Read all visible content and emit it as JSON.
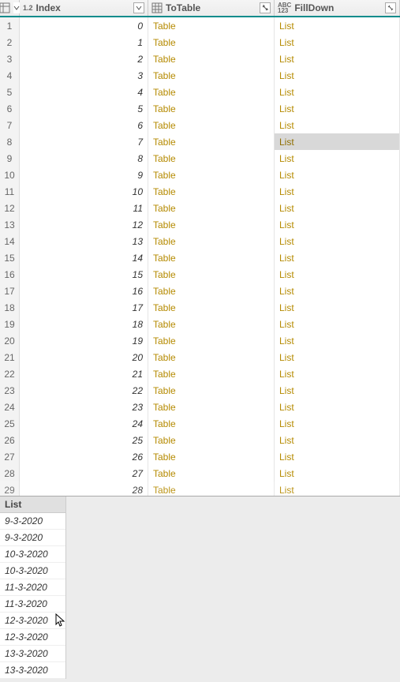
{
  "columns": {
    "index": {
      "label": "Index"
    },
    "totable": {
      "label": "ToTable"
    },
    "filldown": {
      "label": "FillDown"
    }
  },
  "rows": [
    {
      "n": "1",
      "idx": "0",
      "tbl": "Table",
      "fd": "List"
    },
    {
      "n": "2",
      "idx": "1",
      "tbl": "Table",
      "fd": "List"
    },
    {
      "n": "3",
      "idx": "2",
      "tbl": "Table",
      "fd": "List"
    },
    {
      "n": "4",
      "idx": "3",
      "tbl": "Table",
      "fd": "List"
    },
    {
      "n": "5",
      "idx": "4",
      "tbl": "Table",
      "fd": "List"
    },
    {
      "n": "6",
      "idx": "5",
      "tbl": "Table",
      "fd": "List"
    },
    {
      "n": "7",
      "idx": "6",
      "tbl": "Table",
      "fd": "List"
    },
    {
      "n": "8",
      "idx": "7",
      "tbl": "Table",
      "fd": "List",
      "selected": true
    },
    {
      "n": "9",
      "idx": "8",
      "tbl": "Table",
      "fd": "List"
    },
    {
      "n": "10",
      "idx": "9",
      "tbl": "Table",
      "fd": "List"
    },
    {
      "n": "11",
      "idx": "10",
      "tbl": "Table",
      "fd": "List"
    },
    {
      "n": "12",
      "idx": "11",
      "tbl": "Table",
      "fd": "List"
    },
    {
      "n": "13",
      "idx": "12",
      "tbl": "Table",
      "fd": "List"
    },
    {
      "n": "14",
      "idx": "13",
      "tbl": "Table",
      "fd": "List"
    },
    {
      "n": "15",
      "idx": "14",
      "tbl": "Table",
      "fd": "List"
    },
    {
      "n": "16",
      "idx": "15",
      "tbl": "Table",
      "fd": "List"
    },
    {
      "n": "17",
      "idx": "16",
      "tbl": "Table",
      "fd": "List"
    },
    {
      "n": "18",
      "idx": "17",
      "tbl": "Table",
      "fd": "List"
    },
    {
      "n": "19",
      "idx": "18",
      "tbl": "Table",
      "fd": "List"
    },
    {
      "n": "20",
      "idx": "19",
      "tbl": "Table",
      "fd": "List"
    },
    {
      "n": "21",
      "idx": "20",
      "tbl": "Table",
      "fd": "List"
    },
    {
      "n": "22",
      "idx": "21",
      "tbl": "Table",
      "fd": "List"
    },
    {
      "n": "23",
      "idx": "22",
      "tbl": "Table",
      "fd": "List"
    },
    {
      "n": "24",
      "idx": "23",
      "tbl": "Table",
      "fd": "List"
    },
    {
      "n": "25",
      "idx": "24",
      "tbl": "Table",
      "fd": "List"
    },
    {
      "n": "26",
      "idx": "25",
      "tbl": "Table",
      "fd": "List"
    },
    {
      "n": "27",
      "idx": "26",
      "tbl": "Table",
      "fd": "List"
    },
    {
      "n": "28",
      "idx": "27",
      "tbl": "Table",
      "fd": "List"
    },
    {
      "n": "29",
      "idx": "28",
      "tbl": "Table",
      "fd": "List",
      "partial": true
    }
  ],
  "preview": {
    "title": "List",
    "items": [
      "9-3-2020",
      "9-3-2020",
      "10-3-2020",
      "10-3-2020",
      "11-3-2020",
      "11-3-2020",
      "12-3-2020",
      "12-3-2020",
      "13-3-2020",
      "13-3-2020"
    ]
  }
}
